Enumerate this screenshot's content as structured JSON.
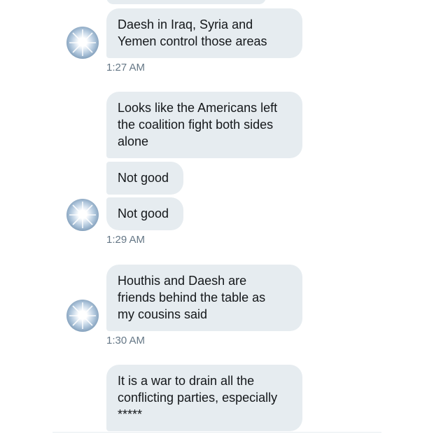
{
  "messages": [
    {
      "text": "Daesh in Iraq, Syria and\nYemen control those areas"
    },
    {
      "time": "1:27 AM"
    },
    {
      "text": "Looks like the Americans left\nthe coalition fight both sides\nalone"
    },
    {
      "text": "Not good"
    },
    {
      "text": "Not good"
    },
    {
      "time": "1:29 AM"
    },
    {
      "text": "Houthis and Daesh are\nfriends behind the table as\nmy cousins said"
    },
    {
      "time": "1:30 AM"
    },
    {
      "text": "It is a war to drain all the\nconflicting parties, especially\n*****"
    }
  ],
  "avatar_icon": "sun-flare-avatar"
}
